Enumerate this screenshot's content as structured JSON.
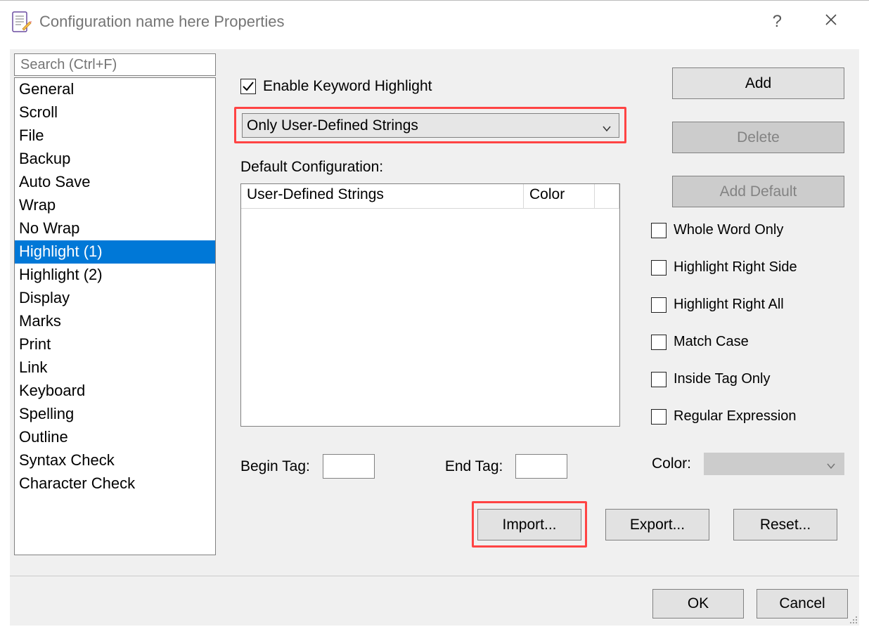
{
  "titlebar": {
    "title": "Configuration name here Properties"
  },
  "search": {
    "placeholder": "Search (Ctrl+F)"
  },
  "sidebar": {
    "items": [
      "General",
      "Scroll",
      "File",
      "Backup",
      "Auto Save",
      "Wrap",
      "No Wrap",
      "Highlight (1)",
      "Highlight (2)",
      "Display",
      "Marks",
      "Print",
      "Link",
      "Keyboard",
      "Spelling",
      "Outline",
      "Syntax Check",
      "Character Check"
    ],
    "selected_index": 7
  },
  "enable_checkbox": {
    "label": "Enable Keyword Highlight",
    "checked": true
  },
  "dropdown": {
    "value": "Only User-Defined Strings"
  },
  "default_label": "Default Configuration:",
  "table": {
    "headers": [
      "User-Defined Strings",
      "Color"
    ]
  },
  "tags": {
    "begin_label": "Begin Tag:",
    "begin_value": "",
    "end_label": "End Tag:",
    "end_value": ""
  },
  "right_buttons": {
    "add": "Add",
    "delete": "Delete",
    "add_default": "Add Default"
  },
  "options": [
    "Whole Word Only",
    "Highlight Right Side",
    "Highlight Right All",
    "Match Case",
    "Inside Tag Only",
    "Regular Expression"
  ],
  "color_row": {
    "label": "Color:"
  },
  "bottom_buttons": {
    "import": "Import...",
    "export": "Export...",
    "reset": "Reset..."
  },
  "dialog_buttons": {
    "ok": "OK",
    "cancel": "Cancel"
  }
}
